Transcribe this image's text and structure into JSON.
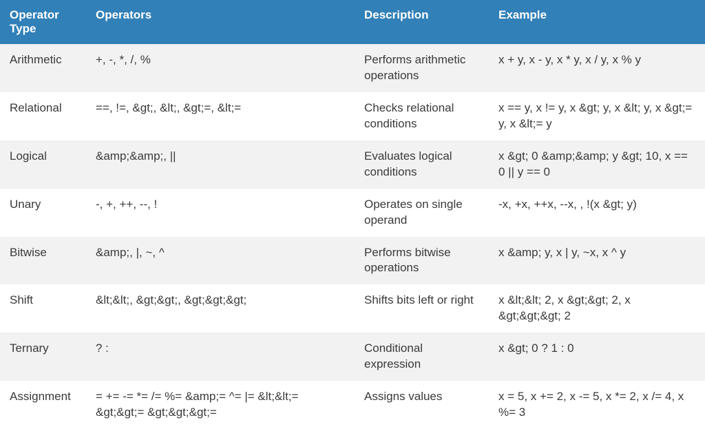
{
  "table": {
    "headers": {
      "type": "Operator Type",
      "operators": "Operators",
      "description": "Description",
      "example": "Example"
    },
    "rows": [
      {
        "type": "Arithmetic",
        "operators": "+, -, *, /, %",
        "description": "Performs arithmetic operations",
        "example": "x + y, x - y, x * y, x / y, x % y"
      },
      {
        "type": "Relational",
        "operators": "==, !=, &gt;, &lt;, &gt;=, &lt;=",
        "description": "Checks relational conditions",
        "example": "x == y, x != y, x &gt; y, x &lt; y, x &gt;= y, x &lt;= y"
      },
      {
        "type": "Logical",
        "operators": "&amp;&amp;, ||",
        "description": "Evaluates logical conditions",
        "example": "x &gt; 0 &amp;&amp; y &gt; 10, x == 0 || y == 0"
      },
      {
        "type": "Unary",
        "operators": "-, +, ++, --, !",
        "description": "Operates on single operand",
        "example": "-x, +x, ++x, --x, , !(x &gt; y)"
      },
      {
        "type": "Bitwise",
        "operators": "&amp;, |, ~, ^",
        "description": "Performs bitwise operations",
        "example": "x &amp; y, x | y, ~x, x ^ y"
      },
      {
        "type": "Shift",
        "operators": "&lt;&lt;, &gt;&gt;, &gt;&gt;&gt;",
        "description": "Shifts bits left or right",
        "example": "x &lt;&lt; 2, x &gt;&gt; 2, x &gt;&gt;&gt; 2"
      },
      {
        "type": "Ternary",
        "operators": "? :",
        "description": "Conditional expression",
        "example": "x &gt; 0 ? 1 : 0"
      },
      {
        "type": "Assignment",
        "operators": "= += -= *= /= %= &amp;= ^= |= &lt;&lt;= &gt;&gt;= &gt;&gt;&gt;=",
        "description": "Assigns values",
        "example": "x = 5, x += 2, x -= 5, x *= 2, x /= 4, x %= 3"
      }
    ]
  }
}
